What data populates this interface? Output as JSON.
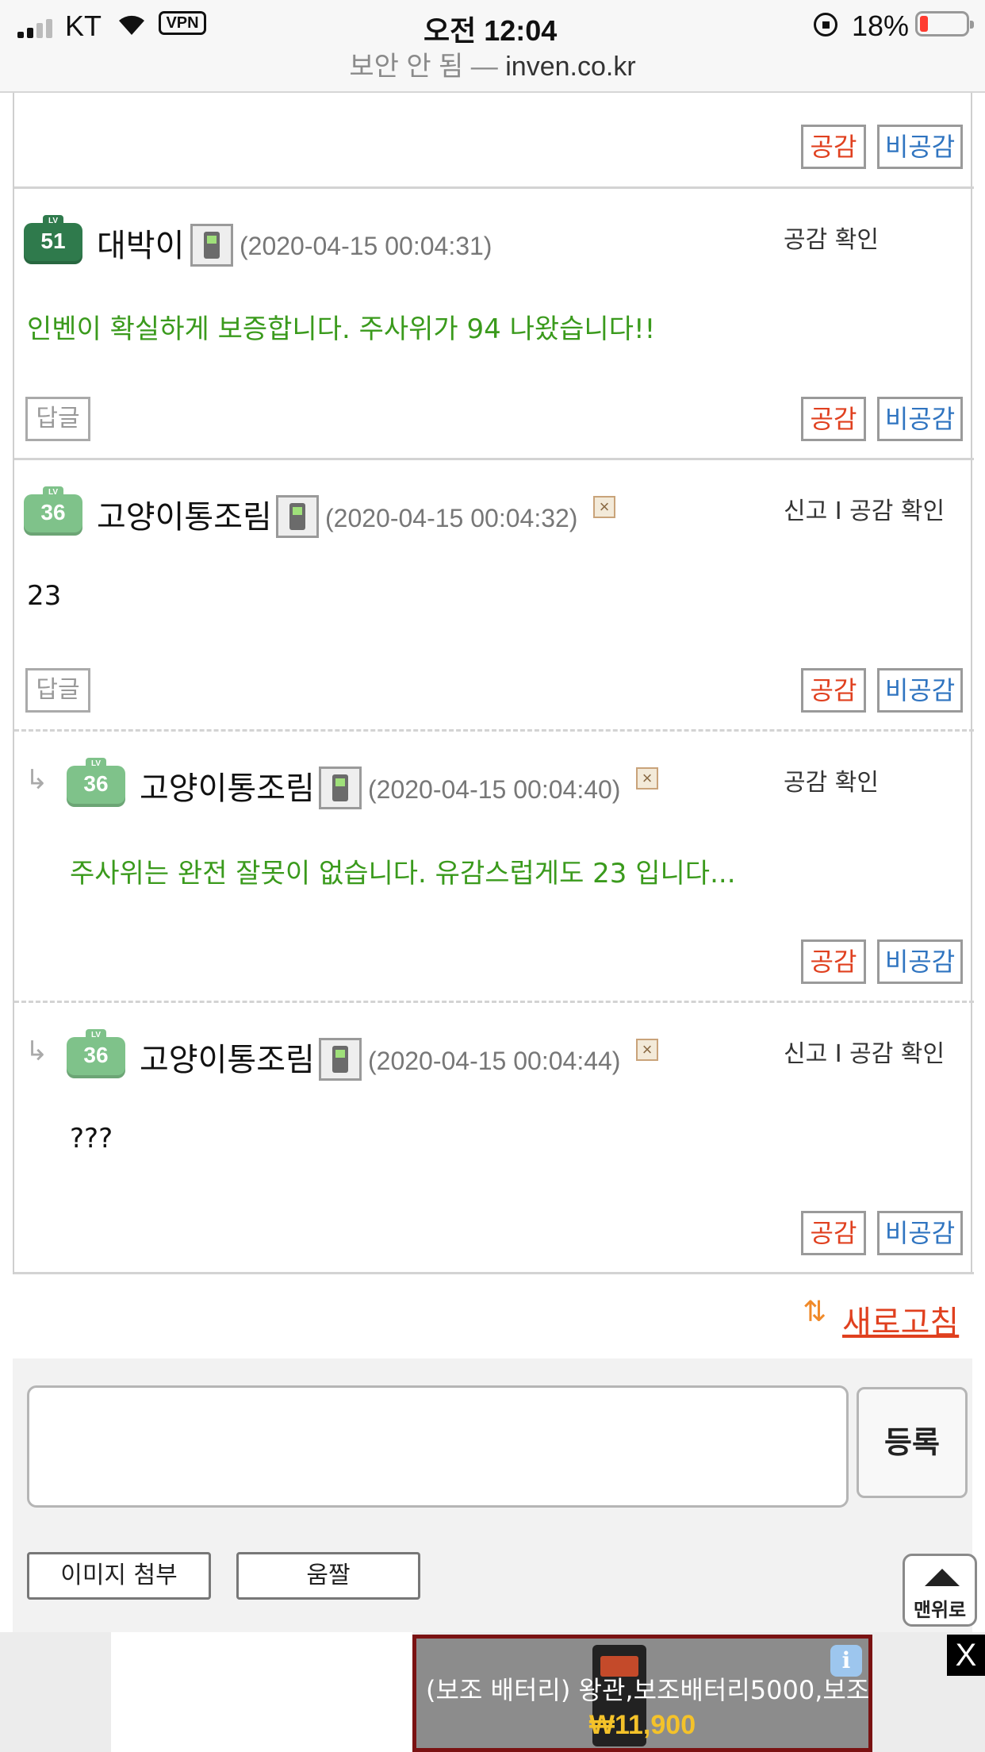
{
  "status_bar": {
    "carrier": "KT",
    "vpn": "VPN",
    "time": "오전 12:04",
    "battery": "18%",
    "url_insecure": "보안 안 됨 —",
    "url_domain": "inven.co.kr"
  },
  "votes": {
    "up": "공감",
    "down": "비공감"
  },
  "reply_label": "답글",
  "comments": [
    {
      "level": "51",
      "nick": "대박이",
      "date": "(2020-04-15 00:04:31)",
      "actions": "공감 확인",
      "text": "인벤이 확실하게 보증합니다. 주사위가 94 나왔습니다!!"
    },
    {
      "level": "36",
      "nick": "고양이통조림",
      "date": "(2020-04-15 00:04:32)",
      "actions": "신고 I 공감 확인",
      "text": "23"
    },
    {
      "level": "36",
      "nick": "고양이통조림",
      "date": "(2020-04-15 00:04:40)",
      "actions": "공감 확인",
      "text": "주사위는 완전 잘못이 없습니다. 유감스럽게도 23 입니다..."
    },
    {
      "level": "36",
      "nick": "고양이통조림",
      "date": "(2020-04-15 00:04:44)",
      "actions": "신고 I 공감 확인",
      "text": "???"
    }
  ],
  "form": {
    "refresh": "새로고침",
    "submit": "등록",
    "attach_image": "이미지 첨부",
    "emoticon": "움짤",
    "top_button": "맨위로"
  },
  "ad": {
    "title": "(보조 배터리) 왕관,보조배터리5000,보조",
    "price": "₩11,900",
    "info_icon": "i",
    "close": "X"
  },
  "icons": {
    "level_badge": "level-badge-icon",
    "mobile": "mobile-phone-icon",
    "broken_image": "broken-image-icon",
    "reply_arrow": "reply-arrow-icon"
  },
  "colors": {
    "vote_up": "#e0401f",
    "vote_down": "#2f74c0",
    "comment_green": "#3a9a1c",
    "ad_price": "#f4c22a"
  }
}
